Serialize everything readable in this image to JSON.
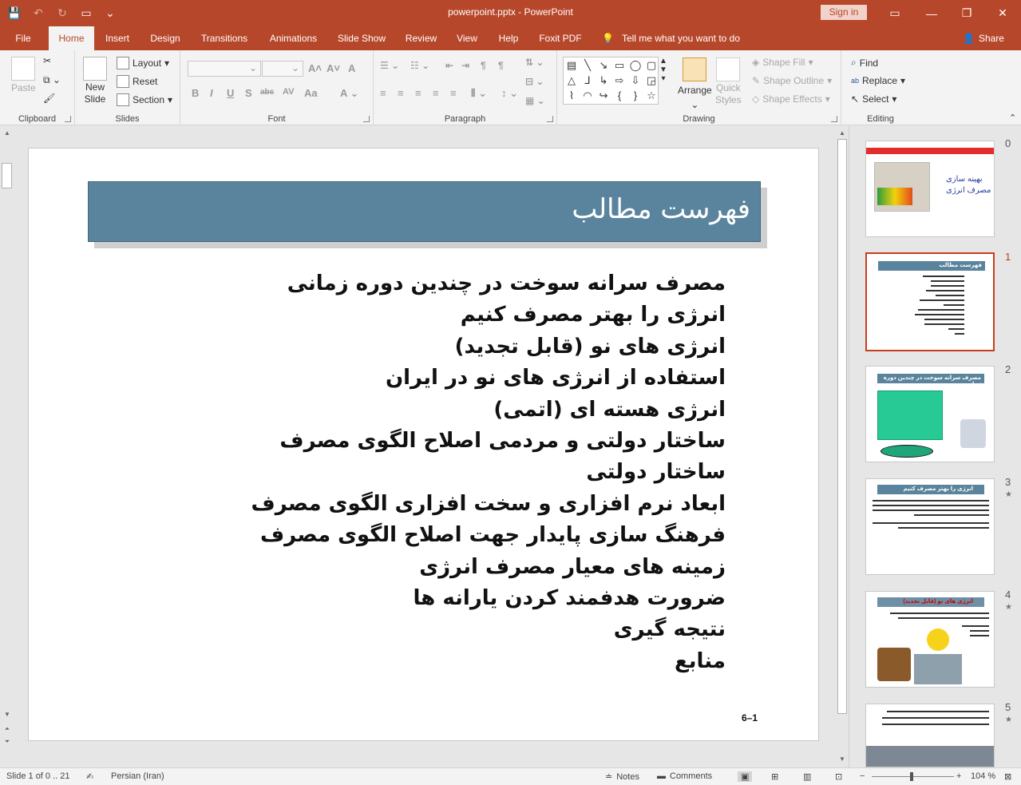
{
  "app": {
    "doc_title": "powerpoint.pptx - PowerPoint",
    "signin": "Sign in",
    "accent": "#b7472a"
  },
  "tabs": [
    "File",
    "Home",
    "Insert",
    "Design",
    "Transitions",
    "Animations",
    "Slide Show",
    "Review",
    "View",
    "Help",
    "Foxit PDF"
  ],
  "active_tab": "Home",
  "tellme": "Tell me what you want to do",
  "share": "Share",
  "ribbon": {
    "clipboard": {
      "label": "Clipboard",
      "paste": "Paste"
    },
    "slides": {
      "label": "Slides",
      "new_slide_1": "New",
      "new_slide_2": "Slide",
      "layout": "Layout",
      "reset": "Reset",
      "section": "Section"
    },
    "font": {
      "label": "Font"
    },
    "paragraph": {
      "label": "Paragraph"
    },
    "drawing": {
      "label": "Drawing",
      "arrange": "Arrange",
      "quick_1": "Quick",
      "quick_2": "Styles",
      "shape_fill": "Shape Fill",
      "shape_outline": "Shape Outline",
      "shape_effects": "Shape Effects"
    },
    "editing": {
      "label": "Editing",
      "find": "Find",
      "replace": "Replace",
      "select": "Select"
    }
  },
  "slide": {
    "title": "فهرست مطالب",
    "bullets": [
      "مصرف سرانه سوخت در چندین دوره زمانی",
      "انرژی را بهتر مصرف کنیم",
      "انرژی های نو (قابل تجدید)",
      "استفاده از انرژی های نو در ایران",
      "انرژی هسته ای (اتمی)",
      "ساختار دولتی و مردمی اصلاح الگوی مصرف",
      "ساختار دولتی",
      "ابعاد نرم افزاری و سخت افزاری الگوی مصرف",
      "فرهنگ سازی پایدار جهت اصلاح الگوی مصرف",
      "زمینه های معیار مصرف انرژی",
      "ضرورت هدفمند کردن یارانه ها",
      "نتیجه گیری",
      "منابع"
    ],
    "number": "6–1",
    "title_bg": "#5a849d"
  },
  "thumbnails": [
    {
      "num": "0",
      "text_1": "بهینه سازی",
      "text_2": "مصرف انرژی"
    },
    {
      "num": "1",
      "title": "فهرست مطالب"
    },
    {
      "num": "2",
      "title": "مصرف سرانه سوخت در چندین دوره زمانی"
    },
    {
      "num": "3",
      "title": "انرژی را بهتر مصرف کنیم"
    },
    {
      "num": "4",
      "title": "انرژی های نو (قابل تجدید)"
    },
    {
      "num": "5"
    }
  ],
  "status": {
    "slide_info": "Slide 1 of 0 .. 21",
    "language": "Persian (Iran)",
    "notes": "Notes",
    "comments": "Comments",
    "zoom": "104 %"
  }
}
